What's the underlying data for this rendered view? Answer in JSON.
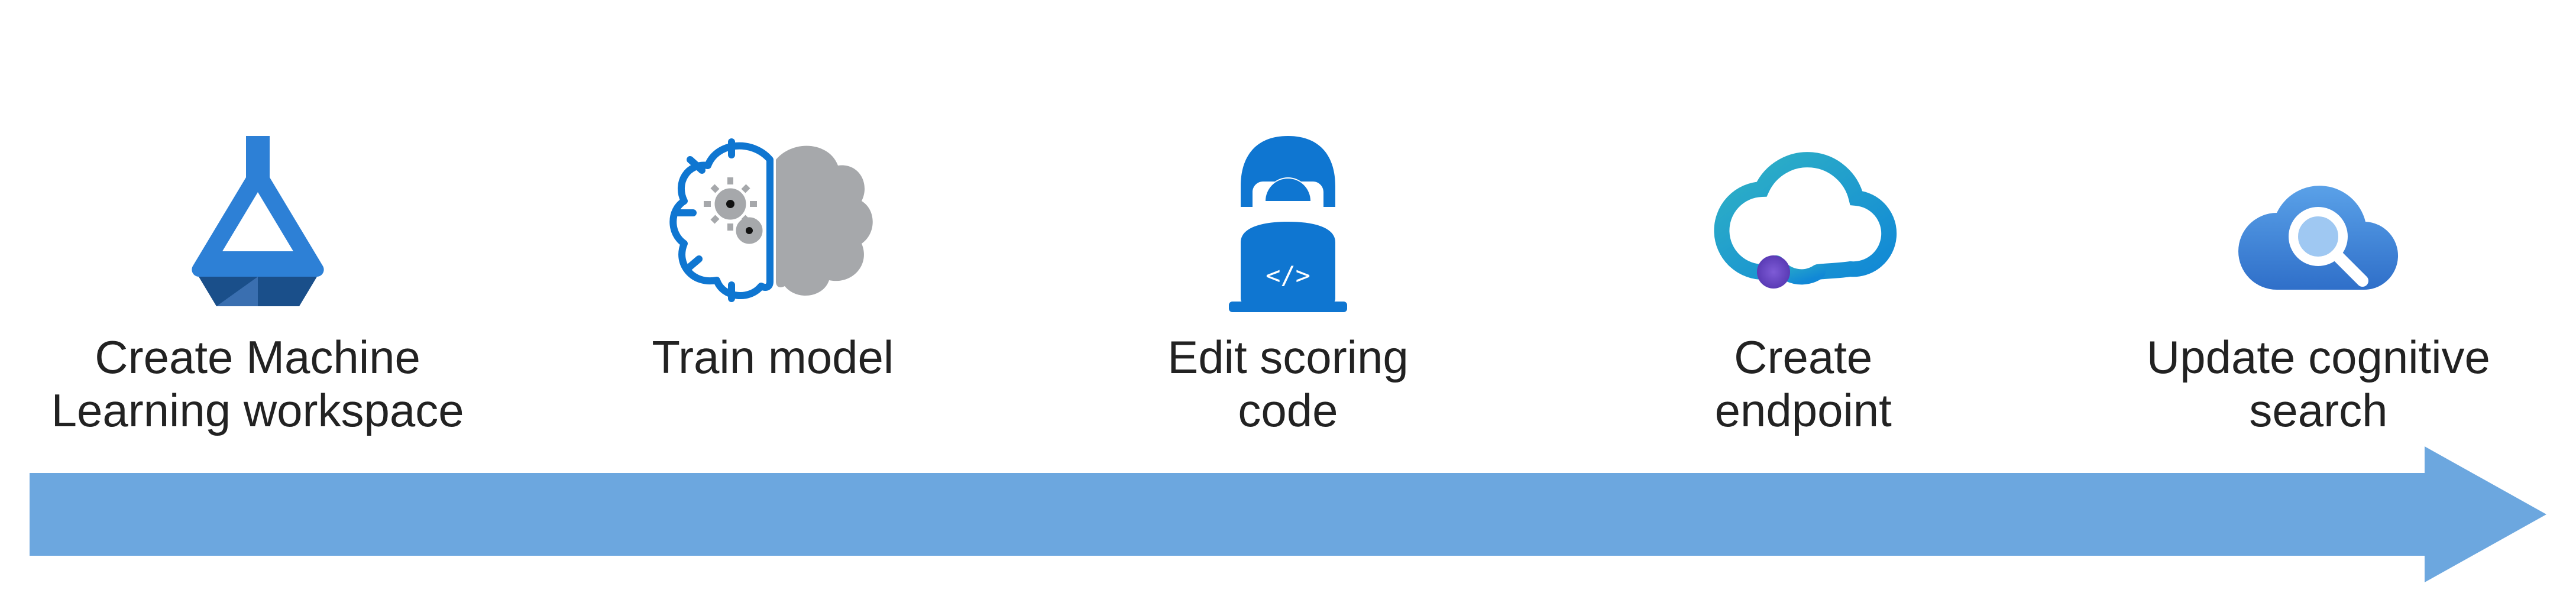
{
  "steps": [
    {
      "label": "Create Machine\nLearning workspace"
    },
    {
      "label": "Train model"
    },
    {
      "label": "Edit scoring\ncode"
    },
    {
      "label": "Create\nendpoint"
    },
    {
      "label": "Update cognitive\nsearch"
    }
  ]
}
